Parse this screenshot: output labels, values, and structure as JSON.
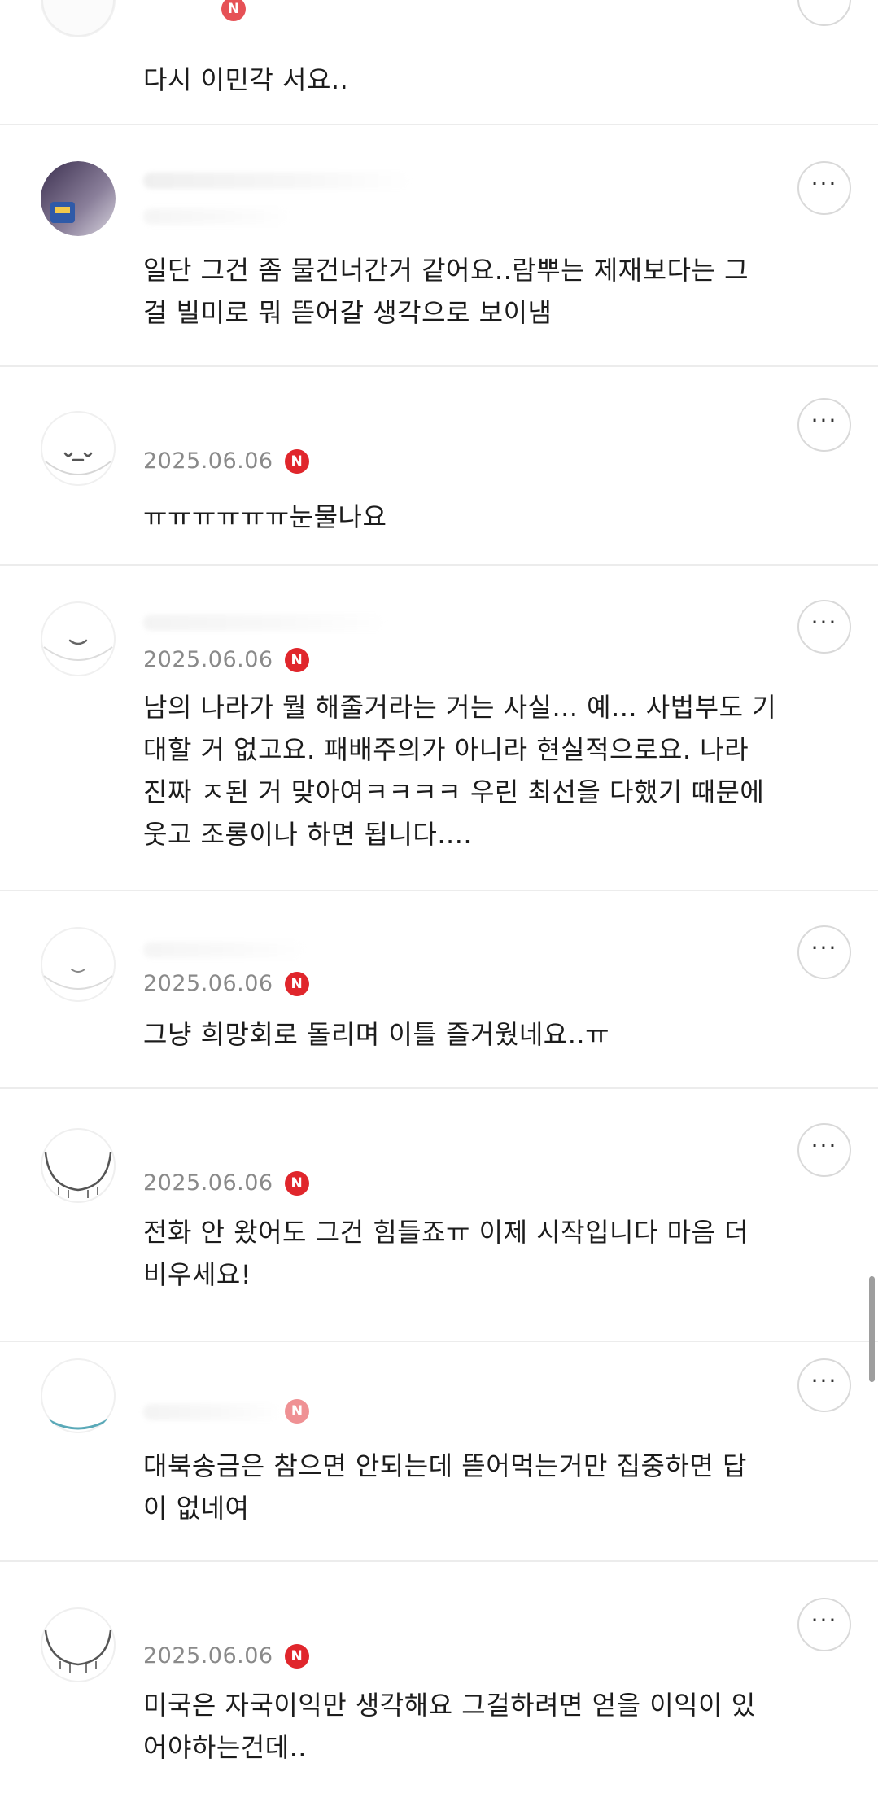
{
  "more_label": "···",
  "badge_letter": "N",
  "badge_color": "#e0262c",
  "comments": [
    {
      "date": "",
      "text": "다시 이민각 서요.."
    },
    {
      "date": "",
      "text": "일단 그건 좀 물건너간거 같어요..람뿌는 제재보다는 그\n걸 빌미로 뭐 뜯어갈 생각으로 보이냄"
    },
    {
      "date": "2025.06.06",
      "text": "ㅠㅠㅠㅠㅠㅠ눈물나요"
    },
    {
      "date": "2025.06.06",
      "text": "남의 나라가 뭘 해줄거라는 거는 사실... 예... 사법부도 기\n대할 거 없고요. 패배주의가 아니라 현실적으로요. 나라\n진짜 ㅈ된 거 맞아여ㅋㅋㅋㅋ 우린 최선을 다했기 때문에\n웃고 조롱이나 하면 됩니다...."
    },
    {
      "date": "2025.06.06",
      "text": "그냥 희망회로 돌리며 이틀 즐거웠네요..ㅠ"
    },
    {
      "date": "2025.06.06",
      "text": "전화 안 왔어도 그건 힘들죠ㅠ 이제 시작입니다 마음 더\n비우세요!"
    },
    {
      "date": "",
      "text": "대북송금은 참으면 안되는데 뜯어먹는거만 집중하면 답\n이 없네여"
    },
    {
      "date": "2025.06.06",
      "text": "미국은 자국이익만 생각해요 그걸하려면 얻을 이익이 있\n어야하는건데.."
    }
  ]
}
